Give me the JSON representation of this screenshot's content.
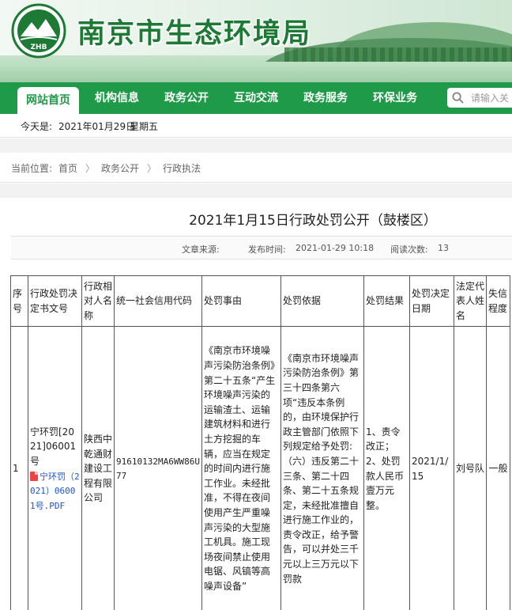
{
  "colors": {
    "brand_green": "#1f9a48",
    "title_green": "#1c7a35"
  },
  "header": {
    "logo_text": "ZHB",
    "site_title": "南京市生态环境局"
  },
  "nav": {
    "items": [
      {
        "label": "网站首页",
        "active": true
      },
      {
        "label": "机构信息"
      },
      {
        "label": "政务公开"
      },
      {
        "label": "互动交流"
      },
      {
        "label": "政务服务"
      },
      {
        "label": "环保业务"
      }
    ],
    "search_placeholder": "请输入关",
    "search_icon": "search-icon"
  },
  "datebar": {
    "prefix": "今天是:",
    "date": "2021年01月29日",
    "weekday": "星期五"
  },
  "breadcrumb": {
    "prefix": "当前位置:",
    "items": [
      "首页",
      "政务公开",
      "行政执法"
    ],
    "separator": "〉"
  },
  "article": {
    "title": "2021年1月15日行政处罚公开（鼓楼区）",
    "source_label": "文章来源:",
    "publish_label": "发布时间:",
    "publish_time": "2021-01-29 10:18",
    "views_label": "阅读次数:",
    "views": "13"
  },
  "table": {
    "headers": [
      "序号",
      "行政处罚决定书文号",
      "行政相对人名称",
      "统一社会信用代码",
      "处罚事由",
      "处罚依据",
      "处罚结果",
      "处罚决定日期",
      "法定代表人姓名",
      "失信程度"
    ],
    "rows": [
      {
        "no": "1",
        "doc_no": "宁环罚[2021]06001号",
        "attachment": "宁环罚（2021）06001号.PDF",
        "party": "陕西中乾通财建设工程有限公司",
        "credit_code": "91610132MA6WW86U77",
        "reason": "《南京市环境噪声污染防治条例》第二十五条“产生环境噪声污染的运输渣土、运输建筑材料和进行土方挖掘的车辆，应当在规定的时间内进行施工作业。未经批准，不得在夜间使用产生严重噪声污染的大型施工机具。施工现场夜间禁止使用电锯、风镐等高噪声设备”",
        "basis_1": "《南京市环境噪声污染防治条例》第三十四条第六项“违反本条例的，由环境保护行政主管部门依照下列规定给予处罚:",
        "basis_2": "（六）违反第二十三条、第二十四条、第二十五条规定，未经批准擅自进行施工作业的，责令改正，给予警告，可以并处三千元以上三万元以下罚款",
        "result_1": "1、责令改正；",
        "result_2": "2、处罚款人民币壹万元整。",
        "date": "2021/1/15",
        "legal_rep": "刘号队",
        "credit_level": "一般"
      }
    ]
  }
}
